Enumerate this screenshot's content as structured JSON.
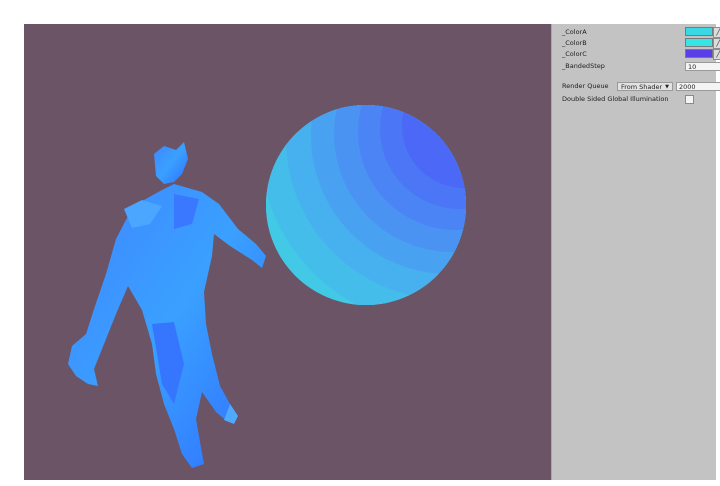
{
  "viewport": {
    "background": "#6a5466"
  },
  "inspector": {
    "properties": [
      {
        "label": "_ColorA",
        "color": "#3ad8e4"
      },
      {
        "label": "_ColorB",
        "color": "#35e6e6"
      },
      {
        "label": "_ColorC",
        "color": "#5a3ee8"
      }
    ],
    "banded_step": {
      "label": "_BandedStep",
      "value": "10"
    },
    "render_queue": {
      "label": "Render Queue",
      "mode": "From Shader",
      "value": "2000"
    },
    "gi": {
      "label": "Double Sided Global Illumination",
      "checked": false
    }
  }
}
